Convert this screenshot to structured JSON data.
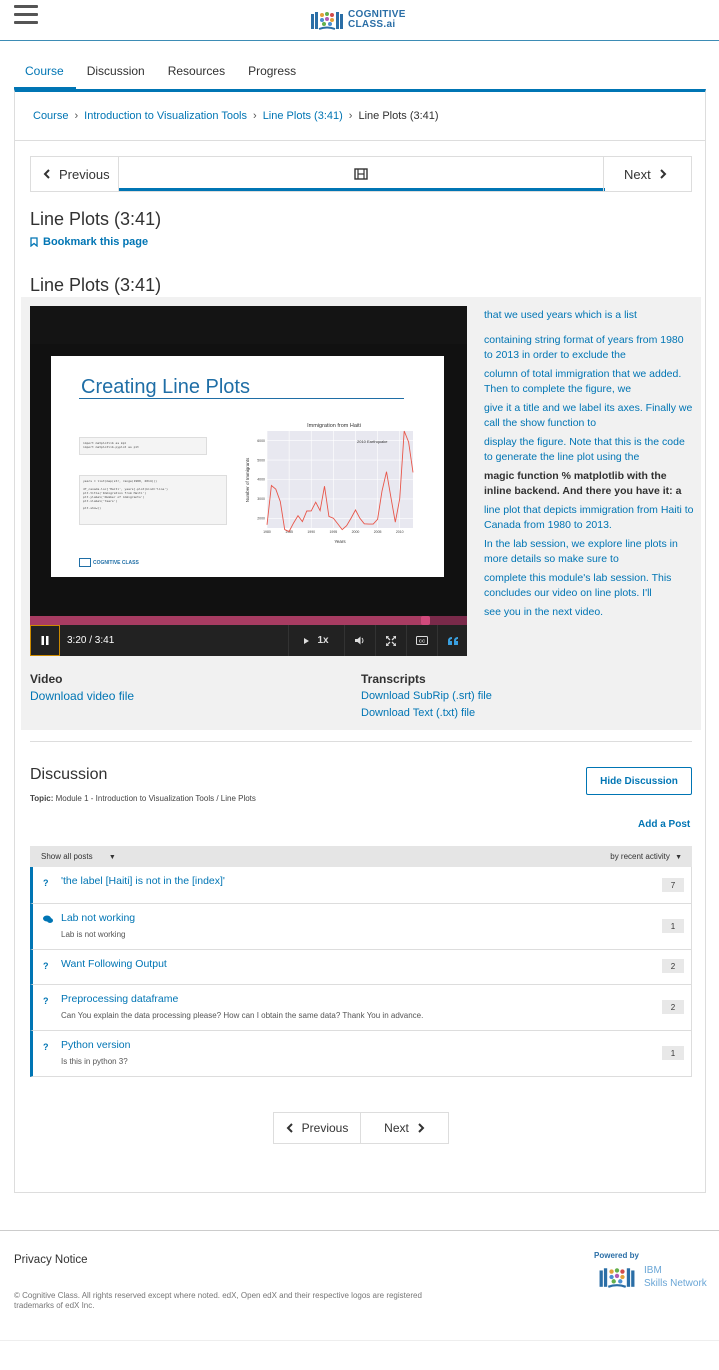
{
  "header": {
    "logo_line1": "COGNITIVE",
    "logo_line2": "CLASS.ai"
  },
  "tabs": [
    {
      "label": "Course",
      "active": true
    },
    {
      "label": "Discussion",
      "active": false
    },
    {
      "label": "Resources",
      "active": false
    },
    {
      "label": "Progress",
      "active": false
    }
  ],
  "breadcrumb": [
    "Course",
    "Introduction to Visualization Tools",
    "Line Plots (3:41)",
    "Line Plots (3:41)"
  ],
  "sequence_nav": {
    "previous_label": "Previous",
    "next_label": "Next"
  },
  "unit": {
    "title": "Line Plots (3:41)",
    "bookmark_label": "Bookmark this page",
    "video_title": "Line Plots (3:41)"
  },
  "video": {
    "slide_title": "Creating Line Plots",
    "chart_title": "Immigration from Haiti",
    "chart_annotation": "2010 Earthquake",
    "chart_ylabel": "Number of Immigrants",
    "chart_xlabel": "Years",
    "chart_yticks": [
      "6000",
      "5000",
      "4000",
      "3000",
      "2000"
    ],
    "chart_xticks": [
      "1980",
      "1985",
      "1990",
      "1995",
      "2000",
      "2005",
      "2010"
    ],
    "slide_logo": "COGNITIVE CLASS",
    "elapsed": "3:20 / 3:41",
    "progress_fraction": 0.905,
    "speed": "1x",
    "code_lines": [
      "import matplotlib as mpl",
      "import matplotlib.pyplot as plt",
      "years = list(map(str, range(1980, 2014)))",
      "df_canada.loc['Haiti', years].plot(kind='line')",
      "plt.title('Immigration from Haiti')",
      "plt.ylabel('Number of immigrants')",
      "plt.xlabel('Years')",
      "plt.show()"
    ]
  },
  "chart_data": {
    "type": "line",
    "title": "Immigration from Haiti",
    "xlabel": "Years",
    "ylabel": "Number of Immigrants",
    "xlim": [
      1980,
      2013
    ],
    "ylim": [
      1500,
      6500
    ],
    "annotations": [
      "2010 Earthquake"
    ],
    "x": [
      1980,
      1981,
      1982,
      1983,
      1984,
      1985,
      1986,
      1987,
      1988,
      1989,
      1990,
      1991,
      1992,
      1993,
      1994,
      1995,
      1996,
      1997,
      1998,
      1999,
      2000,
      2001,
      2002,
      2003,
      2004,
      2005,
      2006,
      2007,
      2008,
      2009,
      2010,
      2011,
      2012,
      2013
    ],
    "series": [
      {
        "values": [
          1666,
          3692,
          3498,
          2860,
          1418,
          1321,
          1753,
          2132,
          1829,
          2377,
          2379,
          2829,
          2399,
          3655,
          2100,
          2004,
          1711,
          1416,
          1620,
          2010,
          2427,
          2002,
          1716,
          1702,
          1705,
          1950,
          3400,
          4400,
          3080,
          1800,
          3000,
          6500,
          5934,
          4364
        ]
      }
    ]
  },
  "transcript": {
    "lines": [
      "that we used years which is a list",
      "containing string format of years from 1980 to 2013 in order to exclude the",
      "column of total immigration that we added. Then to complete the figure, we",
      "give it a title and we label its axes. Finally we call the show function to",
      "display the figure. Note that this is the code to generate the line plot using the",
      "magic function % matplotlib with the inline backend. And there you have it: a",
      "line plot that depicts immigration from Haiti to Canada from 1980 to 2013.",
      "In the lab session, we explore line plots in more details so make sure to",
      "complete this module's lab session. This concludes our video on line plots. I'll",
      "see you in the next video."
    ],
    "current_index": 5
  },
  "downloads": {
    "video_heading": "Video",
    "video_link": "Download video file",
    "transcripts_heading": "Transcripts",
    "srt_link": "Download SubRip (.srt) file",
    "txt_link": "Download Text (.txt) file"
  },
  "discussion": {
    "title": "Discussion",
    "topic_label": "Topic:",
    "topic_value": "Module 1 - Introduction to Visualization Tools / Line Plots",
    "hide_button": "Hide Discussion",
    "add_post": "Add a Post",
    "filter_label": "Show all posts",
    "sort_label": "by recent activity",
    "posts": [
      {
        "type": "question",
        "title": "'the label [Haiti] is not in the [index]'",
        "body": "",
        "count": "7"
      },
      {
        "type": "discussion",
        "title": "Lab not working",
        "body": "Lab is not working",
        "count": "1"
      },
      {
        "type": "question",
        "title": "Want Following Output",
        "body": "",
        "count": "2"
      },
      {
        "type": "question",
        "title": "Preprocessing dataframe",
        "body": "Can You explain the data processing please? How can I obtain the same data? Thank You in advance.",
        "count": "2"
      },
      {
        "type": "question",
        "title": "Python version",
        "body": "Is this in python 3?",
        "count": "1"
      }
    ]
  },
  "bottom_nav": {
    "previous_label": "Previous",
    "next_label": "Next"
  },
  "footer": {
    "privacy": "Privacy Notice",
    "copyright": "© Cognitive Class. All rights reserved except where noted. edX, Open edX and their respective logos are registered trademarks of edX Inc.",
    "powered_by": "Powered by",
    "ibm_line1": "IBM",
    "ibm_line2": "Skills Network"
  },
  "colors": {
    "accent": "#0075b4",
    "progress": "#a83c62",
    "chart_line": "#e8564a"
  }
}
